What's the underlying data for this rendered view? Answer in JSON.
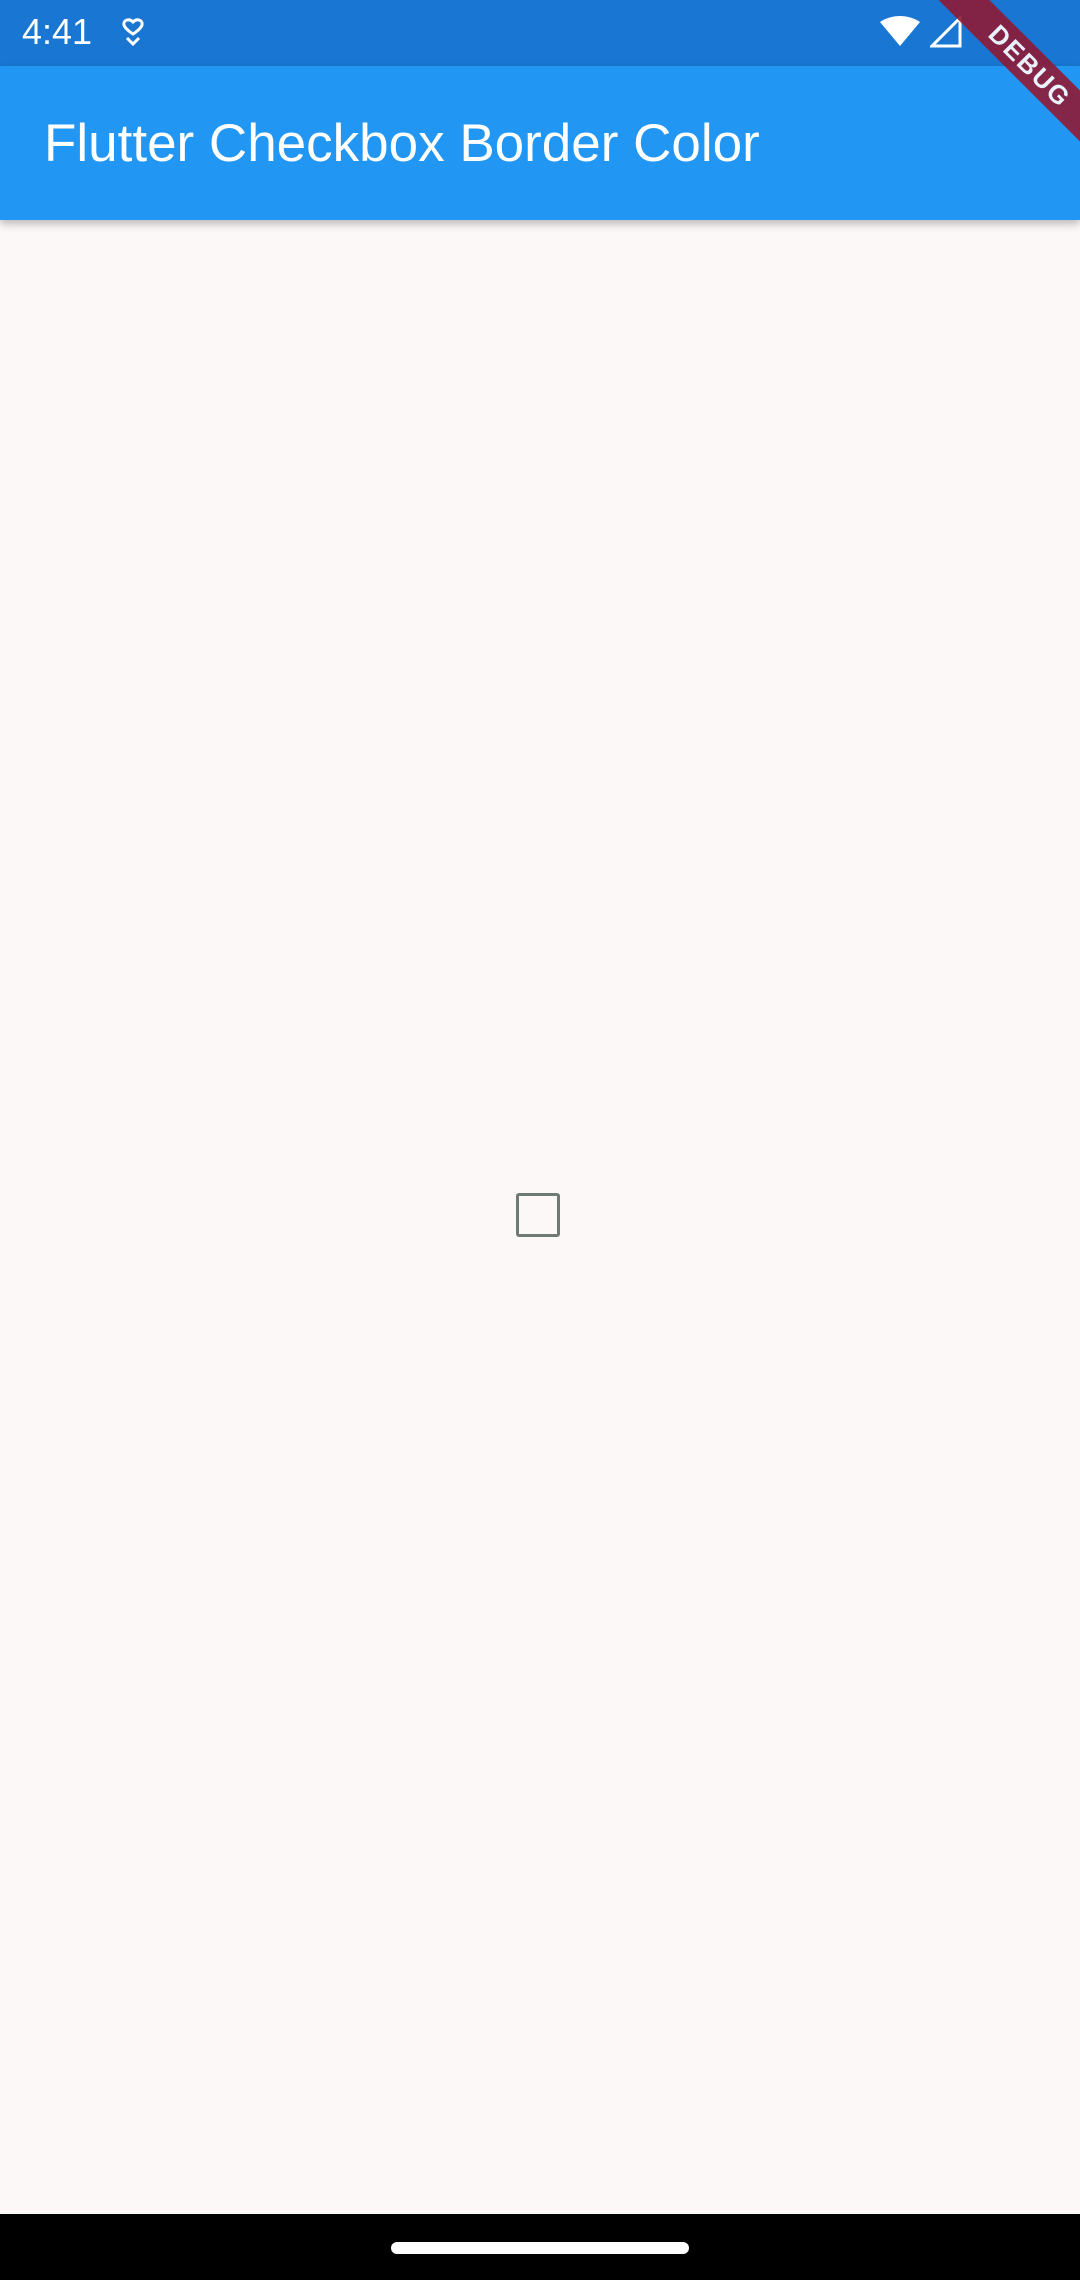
{
  "status_bar": {
    "time": "4:41",
    "notification_icon": "notification-icon",
    "wifi_icon": "wifi-icon",
    "signal_icon": "signal-icon"
  },
  "app_bar": {
    "title": "Flutter Checkbox Border Color"
  },
  "debug_banner": {
    "label": "DEBUG"
  },
  "checkbox": {
    "checked": false,
    "border_color": "#6f7a73"
  },
  "colors": {
    "status_bar": "#1976d2",
    "app_bar": "#2196f3",
    "background": "#fcf8f8",
    "debug_banner": "#8e1a36",
    "nav_bar": "#000000"
  }
}
